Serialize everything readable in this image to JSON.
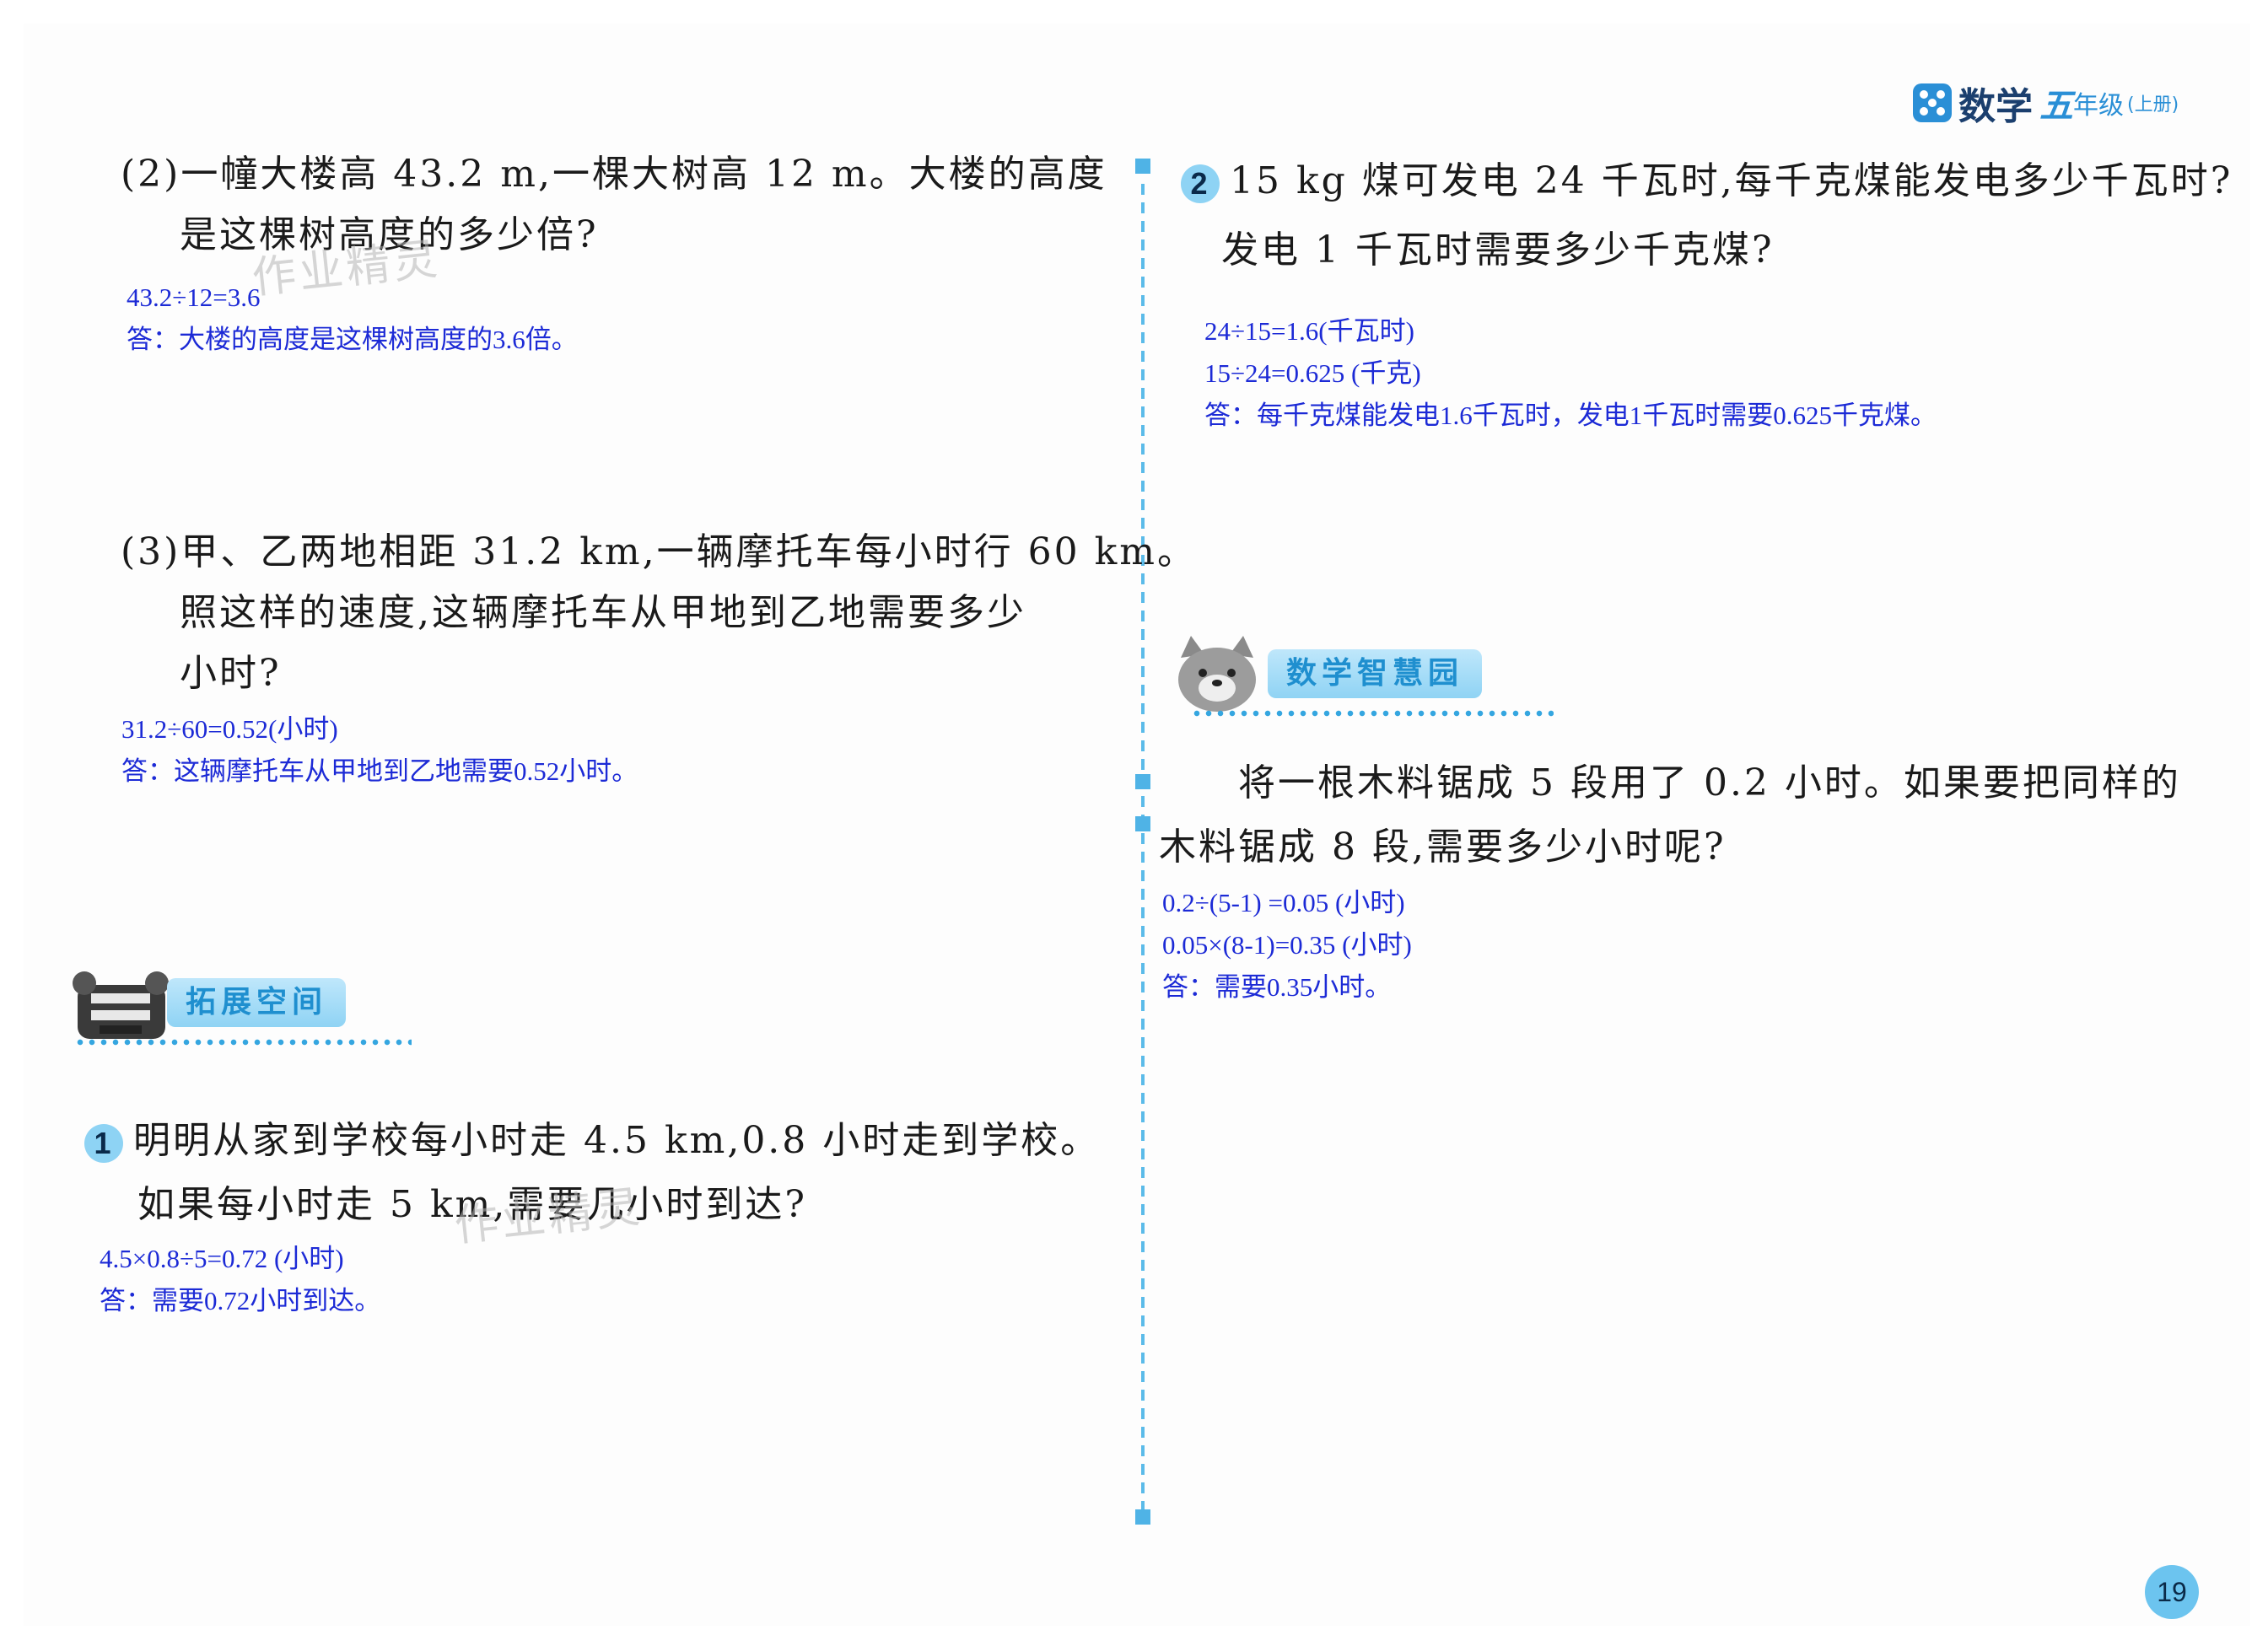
{
  "header": {
    "subject": "数学",
    "grade": "五",
    "grade_suffix": "年级",
    "volume": "(上册)"
  },
  "left": {
    "q2": {
      "line1": "(2)一幢大楼高 43.2 m,一棵大树高 12 m。大楼的高度",
      "line2": "是这棵树高度的多少倍?",
      "ans1": "43.2÷12=3.6",
      "ans2": "答：大楼的高度是这棵树高度的3.6倍。"
    },
    "q3": {
      "line1": "(3)甲、乙两地相距 31.2 km,一辆摩托车每小时行 60 km。",
      "line2": "照这样的速度,这辆摩托车从甲地到乙地需要多少",
      "line3": "小时?",
      "ans1": "31.2÷60=0.52(小时)",
      "ans2": "答：这辆摩托车从甲地到乙地需要0.52小时。"
    },
    "section_title": "拓展空间",
    "ex1": {
      "num": "1",
      "line1": "明明从家到学校每小时走 4.5 km,0.8 小时走到学校。",
      "line2": "如果每小时走 5 km,需要几小时到达?",
      "ans1": "4.5×0.8÷5=0.72 (小时)",
      "ans2": "答：需要0.72小时到达。"
    }
  },
  "right": {
    "ex2": {
      "num": "2",
      "line1": "15 kg 煤可发电 24 千瓦时,每千克煤能发电多少千瓦时?",
      "line2": "发电 1 千瓦时需要多少千克煤?",
      "ans1": "24÷15=1.6(千瓦时)",
      "ans2": "15÷24=0.625 (千克)",
      "ans3": "答：每千克煤能发电1.6千瓦时，发电1千瓦时需要0.625千克煤。"
    },
    "section_title": "数学智慧园",
    "wisdom": {
      "line1": "将一根木料锯成 5 段用了 0.2 小时。如果要把同样的",
      "line2": "木料锯成 8 段,需要多少小时呢?",
      "ans1": "0.2÷(5-1) =0.05 (小时)",
      "ans2": "0.05×(8-1)=0.35 (小时)",
      "ans3": "答：需要0.35小时。"
    }
  },
  "watermark": "作业精灵",
  "page_number": "19",
  "colors": {
    "answer": "#1c2ad6",
    "accent": "#4fb3e6",
    "banner": "#8fd3f4"
  }
}
